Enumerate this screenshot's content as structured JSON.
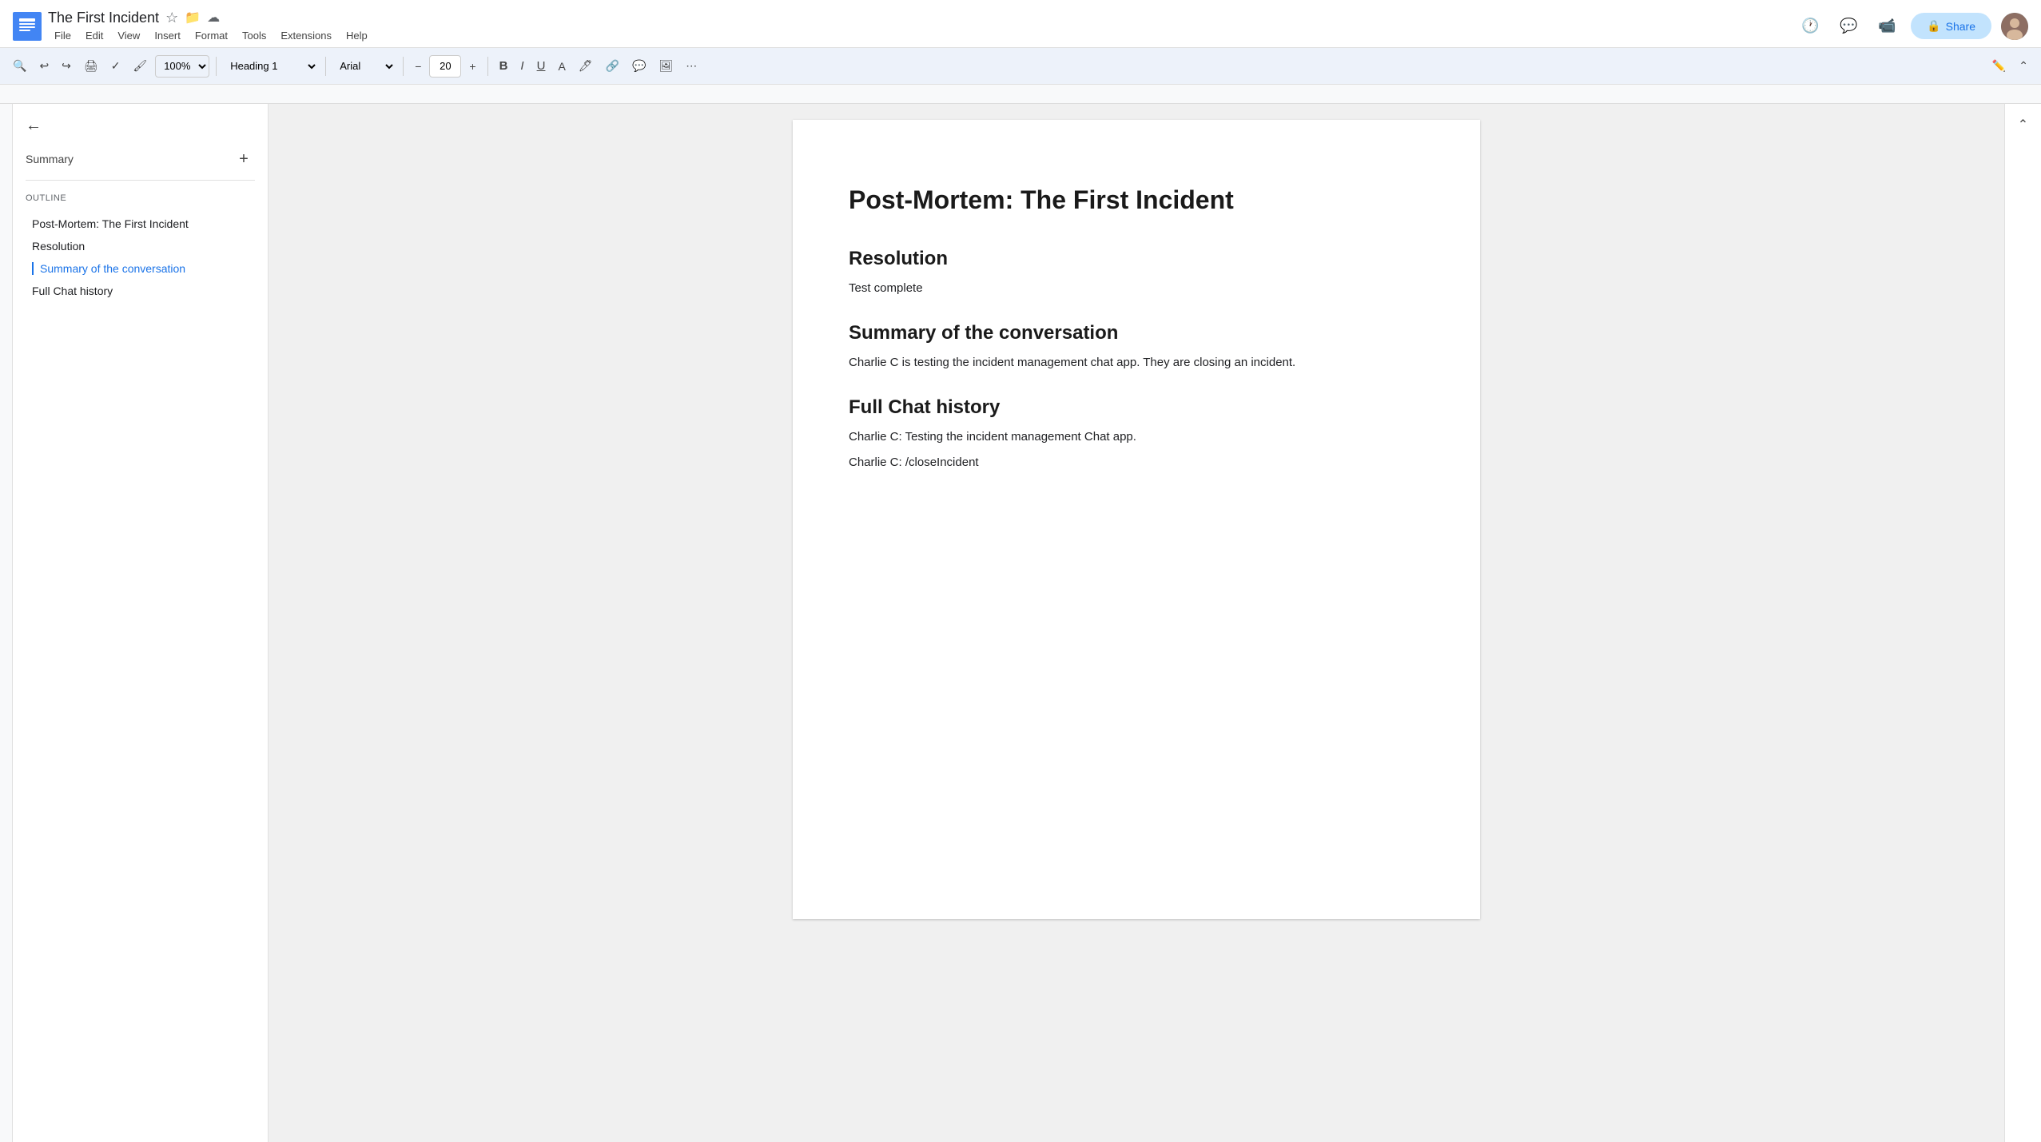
{
  "app": {
    "title": "The First Incident",
    "menu": [
      "File",
      "Edit",
      "View",
      "Insert",
      "Format",
      "Tools",
      "Extensions",
      "Help"
    ],
    "share_label": "Share"
  },
  "toolbar": {
    "zoom": "100%",
    "style": "Heading 1",
    "font": "Arial",
    "font_size": "20",
    "bold": "B",
    "italic": "I",
    "underline": "U"
  },
  "sidebar": {
    "summary_label": "Summary",
    "outline_label": "Outline",
    "outline_items": [
      {
        "label": "Post-Mortem: The First Incident",
        "active": false
      },
      {
        "label": "Resolution",
        "active": false
      },
      {
        "label": "Summary of the conversation",
        "active": true
      },
      {
        "label": "Full Chat history",
        "active": false
      }
    ]
  },
  "document": {
    "title": "Post-Mortem: The First Incident",
    "sections": [
      {
        "heading": "Resolution",
        "body": [
          "Test complete"
        ]
      },
      {
        "heading": "Summary of the conversation",
        "body": [
          "Charlie C is testing the incident management chat app. They are closing an incident."
        ]
      },
      {
        "heading": "Full Chat history",
        "body": [
          "Charlie C: Testing the incident management Chat app.",
          "Charlie C: /closeIncident"
        ]
      }
    ]
  }
}
